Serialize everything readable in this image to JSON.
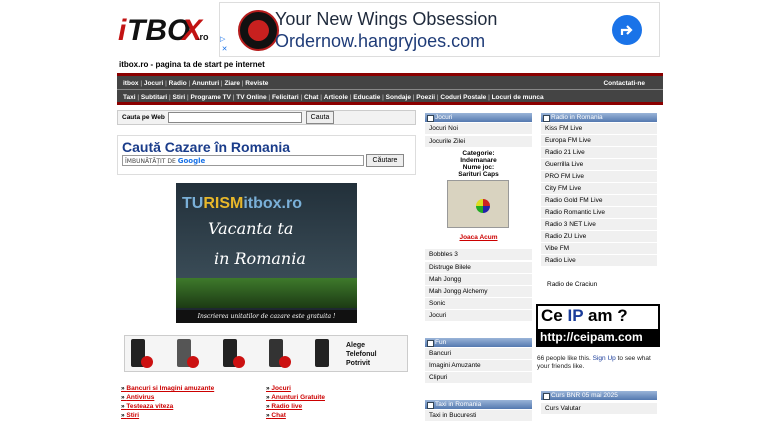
{
  "header": {
    "logo_text": "itbox.ro",
    "tagline": "itbox.ro - pagina ta de start pe internet"
  },
  "ad": {
    "headline": "Your New Wings Obsession",
    "url": "Ordernow.hangryjoes.com"
  },
  "nav": {
    "row1": [
      "itbox",
      "Jocuri",
      "Radio",
      "Anunturi",
      "Ziare",
      "Reviste"
    ],
    "contact": "Contactati-ne",
    "row2": [
      "Taxi",
      "Subtitari",
      "Stiri",
      "Programe TV",
      "TV Online",
      "Felicitari",
      "Chat",
      "Articole",
      "Educatie",
      "Sondaje",
      "Poezii",
      "Coduri Postale",
      "Locuri de munca"
    ]
  },
  "search": {
    "label": "Cauta pe Web",
    "button": "Cauta"
  },
  "cazare": {
    "title": "Caută Cazare în Romania",
    "google_prefix": "ÎMBUNĂTĂȚIT DE",
    "google": "Google",
    "button": "Căutare"
  },
  "turism": {
    "brand_a": "TU",
    "brand_b": "RISM",
    "brand_c": "itbox.ro",
    "line1": "Vacanta ta",
    "line2": "in Romania",
    "footer": "Inscrierea unitatilor de cazare este gratuita !"
  },
  "phones_promo": {
    "line1": "Alege",
    "line2": "Telefonul",
    "line3": "Potrivit"
  },
  "links_left": [
    "Bancuri si Imagini amuzante",
    "Antivirus",
    "Testeaza viteza",
    "Stiri"
  ],
  "links_right": [
    "Jocuri",
    "Anunturi Gratuite",
    "Radio live",
    "Chat"
  ],
  "jocuri": {
    "header": "Jocuri",
    "items_top": [
      "Jocuri Noi",
      "Jocurile Zilei"
    ],
    "category_label": "Categorie:",
    "category": "Indemanare",
    "game_label": "Nume joc:",
    "game": "Sarituri Caps",
    "play": "Joaca Acum",
    "items_bottom": [
      "Bobbles 3",
      "Distruge Bilele",
      "Mah Jongg",
      "Mah Jongg Alchemy",
      "Sonic",
      "Jocuri"
    ]
  },
  "fun": {
    "header": "Fun",
    "items": [
      "Bancuri",
      "Imagini Amuzante",
      "Clipuri"
    ]
  },
  "taxi": {
    "header": "Taxi in Romania",
    "items": [
      "Taxi in Bucuresti"
    ]
  },
  "radio": {
    "header": "Radio in Romania",
    "items": [
      "Kiss FM Live",
      "Europa FM Live",
      "Radio 21 Live",
      "Guerrilla Live",
      "PRO FM Live",
      "City FM Live",
      "Radio Gold FM Live",
      "Radio Romantic Live",
      "Radio 3 NET Live",
      "Radio ZU Live",
      "Vibe FM",
      "Radio Live"
    ],
    "extra": "Radio de Craciun"
  },
  "ceip": {
    "line1a": "Ce ",
    "line1b": "IP",
    "line1c": " am ?",
    "line2": "http://ceipam.com"
  },
  "facebook": {
    "text": "66 people like this.",
    "signup": "Sign Up",
    "rest": "to see what your friends like."
  },
  "curs": {
    "header": "Curs BNR 05 mai 2025",
    "item": "Curs Valutar"
  }
}
